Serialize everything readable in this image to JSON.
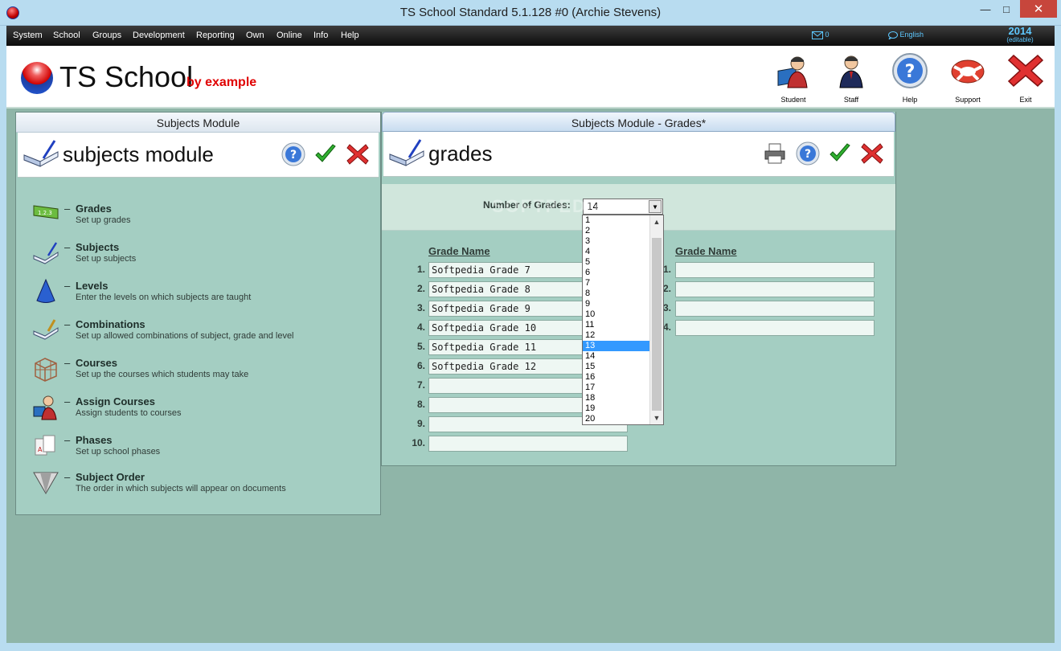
{
  "window": {
    "title": "TS School Standard 5.1.128 #0 (Archie Stevens)"
  },
  "menu": {
    "items": [
      "System",
      "School",
      "Groups",
      "Development",
      "Reporting",
      "Own",
      "Online",
      "Info",
      "Help"
    ],
    "mail_count": "0",
    "language": "English",
    "year": "2014",
    "year_note": "(editable)"
  },
  "header": {
    "logo_text": "TS School",
    "logo_sub": "by example",
    "tools": [
      {
        "label": "Student",
        "icon": "student-icon"
      },
      {
        "label": "Staff",
        "icon": "staff-icon"
      },
      {
        "label": "Help",
        "icon": "help-icon"
      },
      {
        "label": "Support",
        "icon": "lifebuoy-icon"
      },
      {
        "label": "Exit",
        "icon": "exit-icon"
      }
    ]
  },
  "left_panel": {
    "caption": "Subjects Module",
    "title": "subjects module",
    "items": [
      {
        "label": "Grades",
        "desc": "Set up grades",
        "icon": "grades-icon"
      },
      {
        "label": "Subjects",
        "desc": "Set up subjects",
        "icon": "book-icon"
      },
      {
        "label": "Levels",
        "desc": "Enter the levels on which subjects are taught",
        "icon": "cone-icon"
      },
      {
        "label": "Combinations",
        "desc": "Set up allowed combinations of subject, grade and level",
        "icon": "combination-icon"
      },
      {
        "label": "Courses",
        "desc": "Set up the courses which students may take",
        "icon": "cube-icon"
      },
      {
        "label": "Assign Courses",
        "desc": "Assign students to courses",
        "icon": "assign-icon"
      },
      {
        "label": "Phases",
        "desc": "Set up school phases",
        "icon": "phases-icon"
      },
      {
        "label": "Subject Order",
        "desc": "The order in which subjects will appear on documents",
        "icon": "funnel-icon"
      }
    ]
  },
  "right_panel": {
    "caption": "Subjects Module - Grades*",
    "title": "grades",
    "num_grades_label": "Number of Grades:",
    "num_grades_value": "14",
    "col_header_1": "Grade Name",
    "col_header_2": "Grade Name",
    "grades_col1": [
      "Softpedia Grade 7",
      "Softpedia Grade 8",
      "Softpedia Grade 9",
      "Softpedia Grade 10",
      "Softpedia Grade 11",
      "Softpedia Grade 12",
      "",
      "",
      "",
      ""
    ],
    "grades_col2": [
      "",
      "",
      "",
      ""
    ],
    "row_numbers": [
      "1.",
      "2.",
      "3.",
      "4.",
      "5.",
      "6.",
      "7.",
      "8.",
      "9.",
      "10."
    ]
  },
  "dropdown": {
    "options": [
      "1",
      "2",
      "3",
      "4",
      "5",
      "6",
      "7",
      "8",
      "9",
      "10",
      "11",
      "12",
      "13",
      "14",
      "15",
      "16",
      "17",
      "18",
      "19",
      "20"
    ],
    "highlighted": "13"
  },
  "watermark": "SOFTPEDIA"
}
